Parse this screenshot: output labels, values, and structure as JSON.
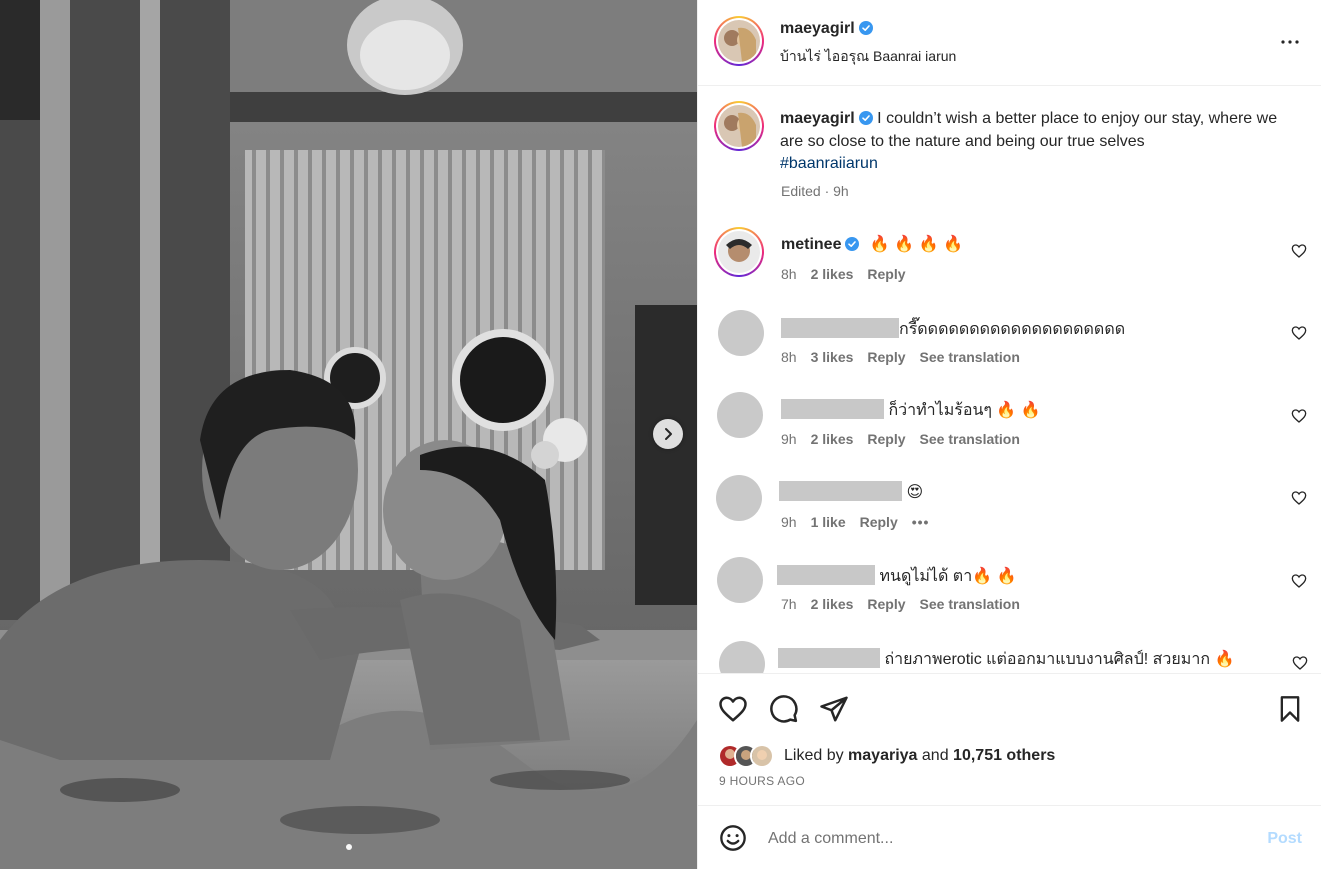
{
  "post": {
    "username": "maeyagirl",
    "location": "บ้านไร่ ไออรุณ Baanrai iarun",
    "caption": "I couldn’t wish a better place to enjoy our stay, where we are so close to the nature and being our true selves",
    "hashtag": "#baanraiiarun",
    "caption_meta": "Edited · 9h"
  },
  "comments": [
    {
      "username": "metinee",
      "text": "🔥 🔥 🔥 🔥",
      "time": "8h",
      "likes": "2 likes",
      "reply": "Reply"
    },
    {
      "text": "กรี๊ดดดดดดดดดดดดดดดดดดดด",
      "time": "8h",
      "likes": "3 likes",
      "reply": "Reply",
      "translate": "See translation"
    },
    {
      "text": "ก็ว่าทำไมร้อนๆ 🔥 🔥",
      "time": "9h",
      "likes": "2 likes",
      "reply": "Reply",
      "translate": "See translation"
    },
    {
      "text": "😍",
      "time": "9h",
      "likes": "1 like",
      "reply": "Reply",
      "more": "•••"
    },
    {
      "text": "ทนดูไม่ได้ ตา🔥 🔥",
      "time": "7h",
      "likes": "2 likes",
      "reply": "Reply",
      "translate": "See translation"
    },
    {
      "text": "ถ่ายภาพerotic แต่ออกมาแบบงานศิลป์! สวยมาก 🔥"
    }
  ],
  "liked": {
    "prefix": "Liked by",
    "user": "mayariya",
    "and": "and",
    "others": "10,751 others",
    "time_ago": "9 HOURS AGO"
  },
  "composer": {
    "placeholder": "Add a comment...",
    "post_label": "Post"
  },
  "colors": {
    "verified": "#3897f0",
    "hashtag": "#00376b",
    "muted": "#737373",
    "post_disabled": "#b3dbff"
  },
  "icons": [
    "verified-icon",
    "more-icon",
    "heart-icon",
    "comment-icon",
    "share-icon",
    "bookmark-icon",
    "emoji-icon",
    "chevron-right-icon"
  ],
  "carousel": {
    "count": 1,
    "active": 0
  }
}
